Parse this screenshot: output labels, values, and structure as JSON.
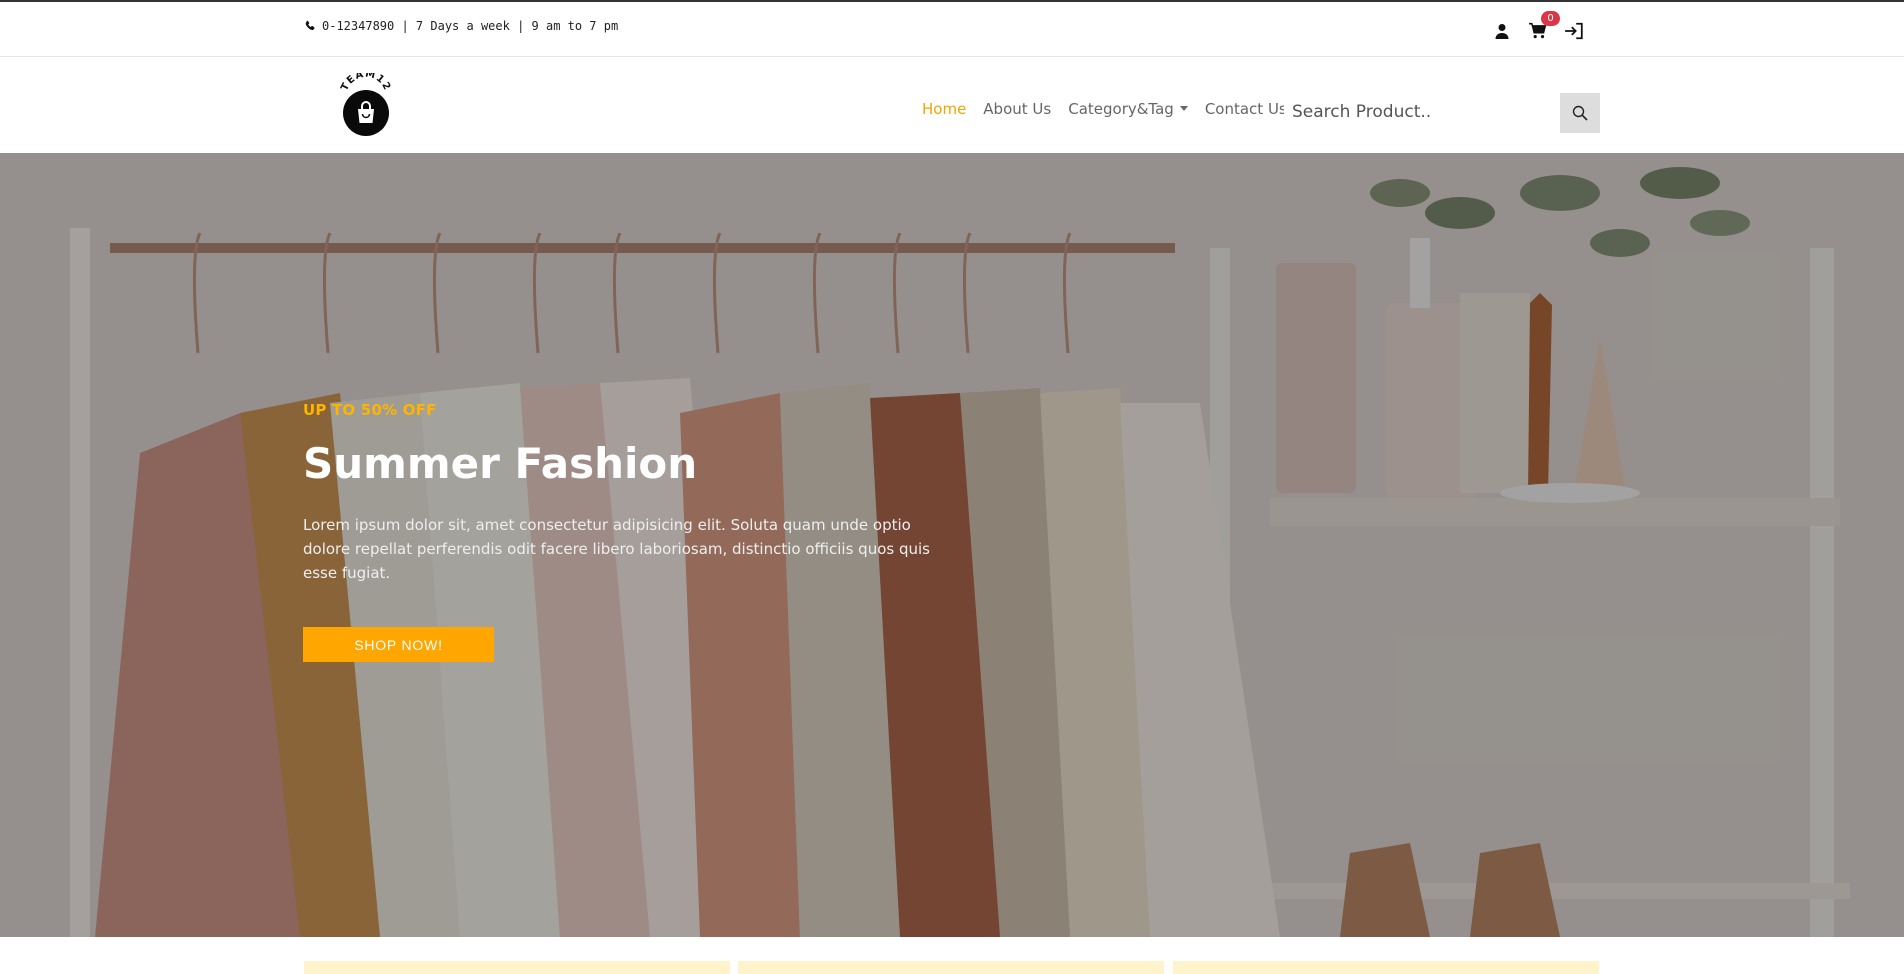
{
  "topbar": {
    "contact_text": "0-12347890 | 7 Days a week | 9 am to 7 pm",
    "cart_count": "0",
    "icons": [
      "phone-icon",
      "user-icon",
      "cart-icon",
      "login-icon"
    ]
  },
  "brand": {
    "logo_text": "TEAM12"
  },
  "nav": {
    "items": [
      {
        "label": "Home",
        "active": true
      },
      {
        "label": "About Us"
      },
      {
        "label": "Category&Tag",
        "dropdown": true
      },
      {
        "label": "Contact Us"
      }
    ],
    "search_placeholder": "Search Product.."
  },
  "hero": {
    "kicker": "UP TO 50% OFF",
    "title": "Summer Fashion",
    "text": "Lorem ipsum dolor sit, amet consectetur adipisicing elit. Soluta quam unde optio dolore repellat perferendis odit facere libero laboriosam, distinctio officiis quos quis esse fugiat.",
    "button_label": "SHOP NOW!"
  },
  "colors": {
    "accent": "#ffa600",
    "nav_active": "#f0a500",
    "badge": "#dc3545",
    "strip": "#fff3cc"
  }
}
